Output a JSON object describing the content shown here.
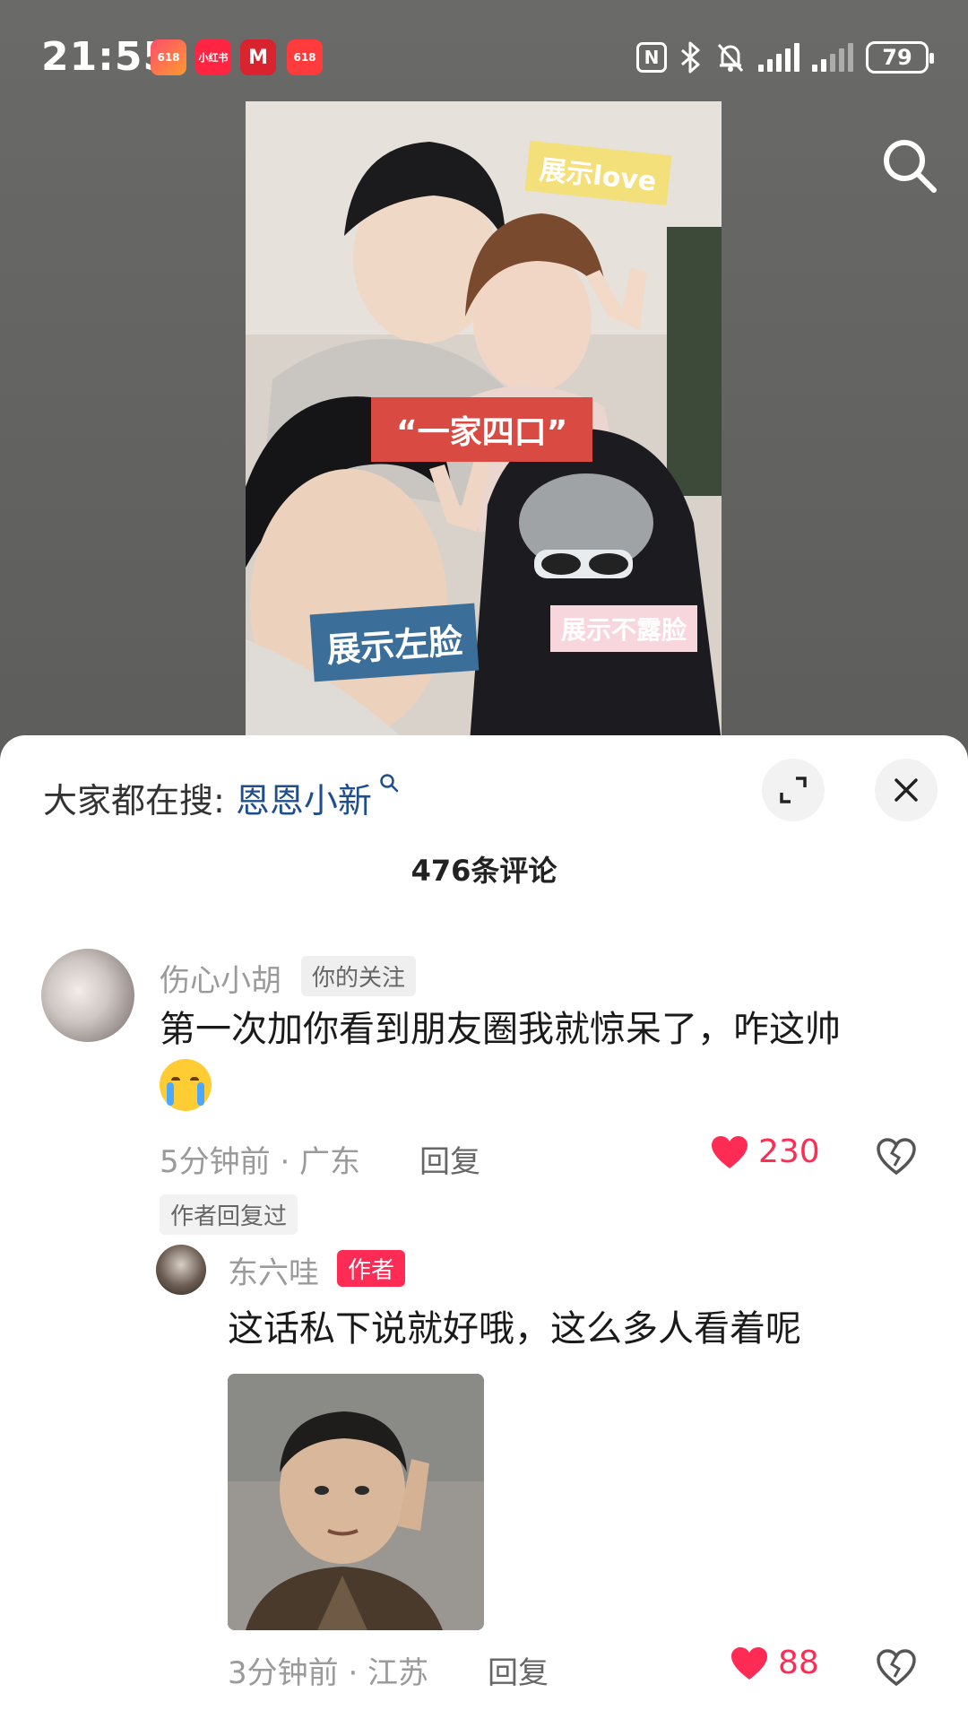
{
  "status_bar": {
    "time": "21:55",
    "apps": [
      "618",
      "小红书",
      "M",
      "618"
    ],
    "battery": "79"
  },
  "photo": {
    "stickers": {
      "love": "展示love",
      "family": "“一家四口”",
      "face": "展示左脸",
      "nofade": "展示不露脸"
    }
  },
  "sheet": {
    "search_prefix": "大家都在搜:",
    "search_keyword": "恩恩小新",
    "comment_count": "476条评论",
    "comments": [
      {
        "user": "伤心小胡",
        "tag": "你的关注",
        "text": "第一次加你看到朋友圈我就惊呆了，咋这帅",
        "emoji": "loudly-crying-face",
        "time_loc": "5分钟前 · 广东",
        "reply_label": "回复",
        "likes": "230",
        "author_replied_tag": "作者回复过"
      },
      {
        "user": "东六哇",
        "tag": "作者",
        "text": "这话私下说就好哦，这么多人看着呢",
        "time_loc": "3分钟前 · 江苏",
        "reply_label": "回复",
        "likes": "88"
      }
    ]
  },
  "colors": {
    "accent": "#fe2c55",
    "keyword": "#1f4e8c",
    "sticker_red": "#d94a43",
    "sticker_blue": "#3b6f9a"
  },
  "icons": [
    "nfc-icon",
    "bluetooth-icon",
    "mute-icon",
    "signal-icon",
    "battery-icon",
    "search-icon",
    "expand-icon",
    "close-icon",
    "heart-icon",
    "broken-heart-icon"
  ]
}
